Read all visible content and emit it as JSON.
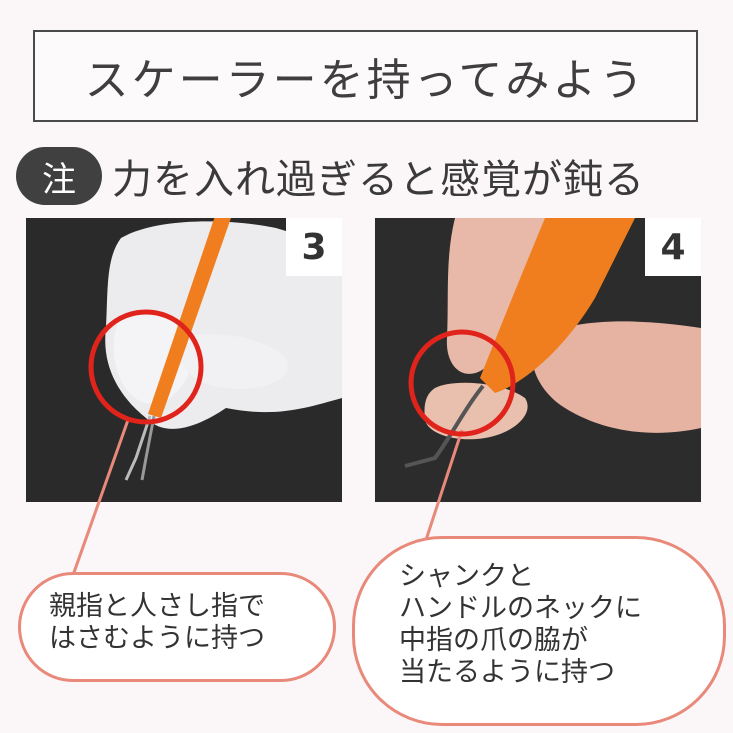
{
  "title": "スケーラーを持ってみよう",
  "warning": {
    "badge": "注",
    "text": "力を入れ過ぎると感覚が鈍る"
  },
  "photos": [
    {
      "number": "3",
      "description_icon": "hand-holding-scaler-photo"
    },
    {
      "number": "4",
      "description_icon": "hand-holding-scaler-photo"
    }
  ],
  "captions": {
    "photo3": [
      "親指と人さし指で",
      "はさむように持つ"
    ],
    "photo4": [
      "シャンクと",
      "ハンドルのネックに",
      "中指の爪の脇が",
      "当たるように持つ"
    ]
  },
  "colors": {
    "accent_circle": "#e0241b",
    "bubble_border": "#e8897a",
    "badge_bg": "#404040",
    "handle_orange": "#f07d1e"
  }
}
